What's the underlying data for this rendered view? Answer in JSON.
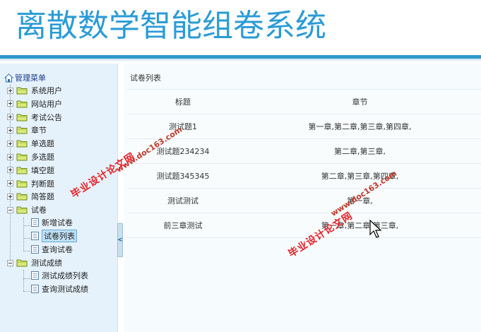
{
  "header": {
    "title": "离散数学智能组卷系统"
  },
  "sidebar": {
    "root_label": "管理菜单",
    "items": [
      {
        "label": "系统用户",
        "expanded": false
      },
      {
        "label": "网站用户",
        "expanded": false
      },
      {
        "label": "考试公告",
        "expanded": false
      },
      {
        "label": "章节",
        "expanded": false
      },
      {
        "label": "单选题",
        "expanded": false
      },
      {
        "label": "多选题",
        "expanded": false
      },
      {
        "label": "填空题",
        "expanded": false
      },
      {
        "label": "判断题",
        "expanded": false
      },
      {
        "label": "简答题",
        "expanded": false
      },
      {
        "label": "试卷",
        "expanded": true,
        "children": [
          {
            "label": "新增试卷",
            "selected": false
          },
          {
            "label": "试卷列表",
            "selected": true
          },
          {
            "label": "查询试卷",
            "selected": false
          }
        ]
      },
      {
        "label": "测试成绩",
        "expanded": true,
        "children": [
          {
            "label": "测试成绩列表",
            "selected": false
          },
          {
            "label": "查询测试成绩",
            "selected": false
          }
        ]
      }
    ],
    "splitter_glyph": "<"
  },
  "main": {
    "panel_title": "试卷列表",
    "columns": [
      "标题",
      "章节"
    ],
    "rows": [
      [
        "测试题1",
        "第一章,第二章,第三章,第四章,"
      ],
      [
        "测试题234234",
        "第二章,第三章,"
      ],
      [
        "测试题345345",
        "第二章,第三章,第四章,"
      ],
      [
        "测试测试",
        "第一章,"
      ],
      [
        "前三章测试",
        "第一章,第二章,第三章,"
      ]
    ]
  },
  "watermarks": {
    "text_cn": "毕业设计论文网",
    "text_url": "www.doc163.com"
  },
  "colors": {
    "title_blue": "#2a9bd6",
    "header_bar": "#2f98cc",
    "sidebar_bg": "#e6f2fb",
    "selection_bg": "#bfe0f5",
    "watermark_red": "#e8232a"
  }
}
